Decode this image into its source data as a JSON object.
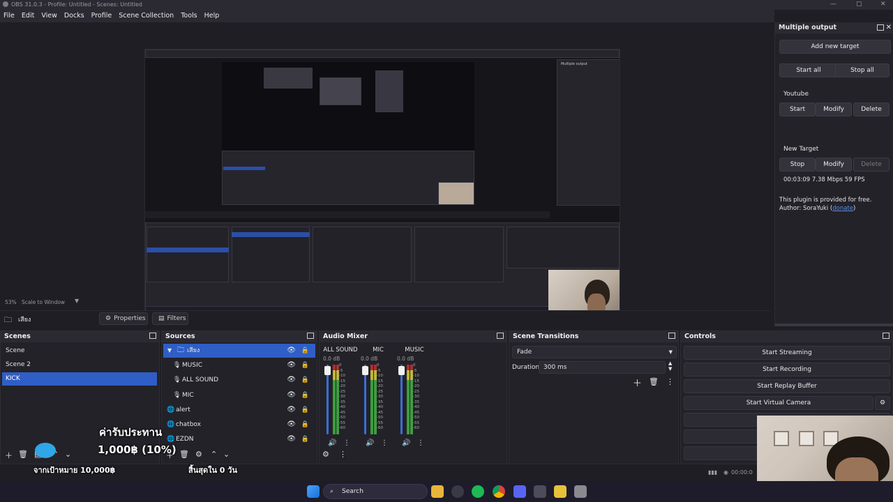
{
  "window": {
    "title": "OBS 31.0.3 - Profile: Untitled - Scenes: Untitled",
    "minimize": "—",
    "maximize": "▢",
    "close": "✕"
  },
  "menu": [
    "File",
    "Edit",
    "View",
    "Docks",
    "Profile",
    "Scene Collection",
    "Tools",
    "Help"
  ],
  "preview": {
    "zoom": "53%",
    "scale_mode": "Scale to Window"
  },
  "context": {
    "source_name": "เสียง",
    "properties_label": "Properties",
    "filters_label": "Filters"
  },
  "scenes": {
    "title": "Scenes",
    "items": [
      {
        "label": "Scene",
        "selected": false
      },
      {
        "label": "Scene 2",
        "selected": false
      },
      {
        "label": "KICK",
        "selected": true
      }
    ]
  },
  "sources": {
    "title": "Sources",
    "items": [
      {
        "label": "เสียง",
        "type": "group",
        "selected": true
      },
      {
        "label": "MUSIC",
        "type": "audio",
        "selected": false
      },
      {
        "label": "ALL SOUND",
        "type": "audio",
        "selected": false
      },
      {
        "label": "MIC",
        "type": "audio",
        "selected": false
      },
      {
        "label": "alert",
        "type": "browser",
        "selected": false
      },
      {
        "label": "chatbox",
        "type": "browser",
        "selected": false
      },
      {
        "label": "EZDN",
        "type": "browser",
        "selected": false
      }
    ]
  },
  "audio_mixer": {
    "title": "Audio Mixer",
    "channels": [
      {
        "name": "ALL SOUND",
        "db": "0.0 dB"
      },
      {
        "name": "MIC",
        "db": "0.0 dB"
      },
      {
        "name": "MUSIC",
        "db": "0.0 dB"
      }
    ],
    "ticks": [
      "0",
      "-5",
      "-10",
      "-15",
      "-20",
      "-25",
      "-30",
      "-35",
      "-40",
      "-45",
      "-50",
      "-55",
      "-60"
    ]
  },
  "scene_transitions": {
    "title": "Scene Transitions",
    "transition": "Fade",
    "duration_label": "Duration",
    "duration_value": "300 ms"
  },
  "controls": {
    "title": "Controls",
    "start_streaming": "Start Streaming",
    "start_recording": "Start Recording",
    "start_replay_buffer": "Start Replay Buffer",
    "start_virtual_camera": "Start Virtual Camera"
  },
  "multiple_output": {
    "title": "Multiple output",
    "add_new_target": "Add new target",
    "start_all": "Start all",
    "stop_all": "Stop all",
    "targets": [
      {
        "name": "Youtube",
        "primary": "Start",
        "modify": "Modify",
        "delete": "Delete",
        "delete_disabled": false
      },
      {
        "name": "New Target",
        "primary": "Stop",
        "modify": "Modify",
        "delete": "Delete",
        "delete_disabled": true
      }
    ],
    "stats": "00:03:09  7.38 Mbps  59 FPS",
    "footer_line1": "This plugin is provided for free.",
    "footer_author_prefix": "Author: SoraYuki (",
    "footer_link": "donate",
    "footer_author_suffix": ")"
  },
  "status": {
    "time": "00:00:0"
  },
  "overlay": {
    "donation_title": "ค่ารับประทาน",
    "donation_amount": "1,000฿ (10%)",
    "goal": "จากเป้าหมาย 10,000฿",
    "remaining": "สิ้นสุดใน 0 วัน"
  },
  "taskbar": {
    "search_label": "Search"
  },
  "colors": {
    "accent": "#2f5ec6",
    "panel": "#232229",
    "background": "#1f1e24"
  }
}
